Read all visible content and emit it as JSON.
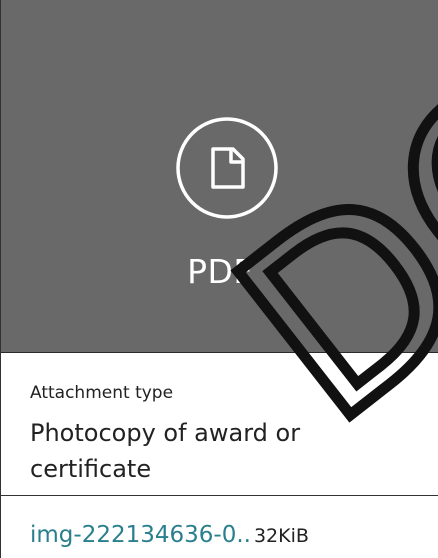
{
  "preview": {
    "icon": "file-icon",
    "label": "PDF",
    "background": "#696969"
  },
  "attachment": {
    "caption": "Attachment type",
    "value": "Photocopy of award or certificate"
  },
  "file": {
    "name": "img-222134636-0..",
    "size": "32KiB",
    "link_color": "#2a7f8e"
  },
  "watermark": {
    "text": "DO"
  }
}
